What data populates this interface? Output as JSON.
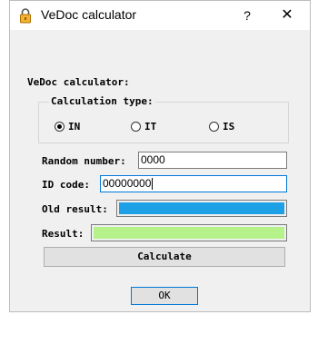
{
  "window": {
    "title": "VeDoc calculator",
    "help_label": "?",
    "close_label": "✕"
  },
  "group": {
    "label": "VeDoc calculator:"
  },
  "calc_type": {
    "label": "Calculation type:",
    "options": [
      {
        "label": "IN",
        "selected": true
      },
      {
        "label": "IT",
        "selected": false
      },
      {
        "label": "IS",
        "selected": false
      }
    ]
  },
  "fields": {
    "random_number": {
      "label": "Random number:",
      "value": "0000"
    },
    "id_code": {
      "label": "ID code:",
      "value": "00000000"
    },
    "old_result": {
      "label": "Old result:",
      "color": "#1ea0e6"
    },
    "result": {
      "label": "Result:",
      "color": "#b5f28a"
    }
  },
  "buttons": {
    "calculate": "Calculate",
    "ok": "OK"
  },
  "colors": {
    "focus_border": "#0078d7",
    "client_bg": "#f0f0f0",
    "lock_icon": "#d98b00"
  },
  "icons": {
    "title_icon": "lock-icon"
  }
}
